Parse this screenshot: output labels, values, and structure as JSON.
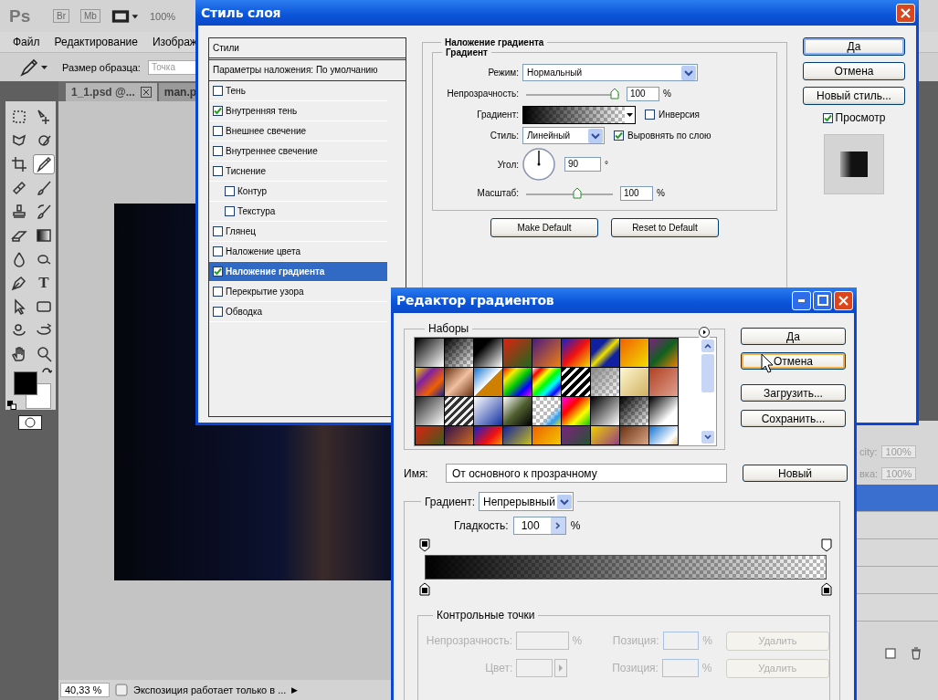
{
  "app": {
    "logo": "Ps",
    "bridge": "Br",
    "mini_bridge": "Mb",
    "zoom_level": "100%",
    "menu": [
      {
        "label": "Файл"
      },
      {
        "label": "Редактирование"
      },
      {
        "label": "Изображ"
      }
    ],
    "options": {
      "label": "Размер образца:",
      "placeholder": "Точка"
    },
    "doc_tabs": [
      {
        "label": "1_1.psd @...",
        "selected": true
      },
      {
        "label": "man.p",
        "selected": false
      }
    ],
    "tools": [
      {
        "kind": "marquee",
        "selected": false
      },
      {
        "kind": "move",
        "selected": false
      },
      {
        "kind": "lasso",
        "selected": false
      },
      {
        "kind": "quick-select",
        "selected": false
      },
      {
        "kind": "crop",
        "selected": false
      },
      {
        "kind": "eyedropper",
        "selected": true
      },
      {
        "kind": "healing",
        "selected": false
      },
      {
        "kind": "brush",
        "selected": false
      },
      {
        "kind": "stamp",
        "selected": false
      },
      {
        "kind": "history-brush",
        "selected": false
      },
      {
        "kind": "eraser",
        "selected": false
      },
      {
        "kind": "gradient",
        "selected": false
      },
      {
        "kind": "blur",
        "selected": false
      },
      {
        "kind": "smudge",
        "selected": false
      },
      {
        "kind": "pen",
        "selected": false
      },
      {
        "kind": "type",
        "label": "T",
        "selected": false
      },
      {
        "kind": "path-select",
        "selected": false
      },
      {
        "kind": "shape",
        "selected": false
      },
      {
        "kind": "rotate-3d",
        "selected": false
      },
      {
        "kind": "orbit-3d",
        "selected": false
      },
      {
        "kind": "hand",
        "selected": false
      },
      {
        "kind": "zoom",
        "selected": false
      }
    ],
    "status": {
      "zoom": "40,33 %",
      "message": "Экспозиция работает только в ...",
      "arrow": "▶"
    },
    "layers_panel": {
      "fields": [
        {
          "label": "city:",
          "value": "100%",
          "disabled": true
        },
        {
          "label": "вка:",
          "value": "100%",
          "disabled": true
        }
      ],
      "rows": [
        {
          "selected": true
        },
        {
          "selected": false
        },
        {
          "selected": false
        },
        {
          "selected": false
        },
        {
          "selected": false
        }
      ]
    }
  },
  "layer_style": {
    "title": "Стиль слоя",
    "styles_header": "Стили",
    "blending": "Параметры наложения: По умолчанию",
    "effects": [
      {
        "label": "Тень",
        "checked": false,
        "selected": false
      },
      {
        "label": "Внутренняя тень",
        "checked": true,
        "selected": false
      },
      {
        "label": "Внешнее свечение",
        "checked": false,
        "selected": false
      },
      {
        "label": "Внутреннее свечение",
        "checked": false,
        "selected": false
      },
      {
        "label": "Тиснение",
        "checked": false,
        "selected": false,
        "children": [
          {
            "label": "Контур",
            "checked": false,
            "selected": false
          },
          {
            "label": "Текстура",
            "checked": false,
            "selected": false
          }
        ]
      },
      {
        "label": "Глянец",
        "checked": false,
        "selected": false
      },
      {
        "label": "Наложение цвета",
        "checked": false,
        "selected": false
      },
      {
        "label": "Наложение градиента",
        "checked": true,
        "selected": true
      },
      {
        "label": "Перекрытие узора",
        "checked": false,
        "selected": false
      },
      {
        "label": "Обводка",
        "checked": false,
        "selected": false
      }
    ],
    "section_title": "Наложение градиента",
    "group_title": "Градиент",
    "mode": {
      "label": "Режим:",
      "value": "Нормальный"
    },
    "opacity": {
      "label": "Непрозрачность:",
      "level": 1,
      "value": "100",
      "unit": "%"
    },
    "gradient": {
      "label": "Градиент:"
    },
    "reverse": {
      "label": "Инверсия",
      "checked": false
    },
    "style": {
      "label": "Стиль:",
      "value": "Линейный"
    },
    "align": {
      "label": "Выровнять по слою",
      "checked": true
    },
    "angle": {
      "label": "Угол:",
      "value": "90",
      "unit": "°"
    },
    "scale": {
      "label": "Масштаб:",
      "level": 0.6,
      "value": "100",
      "unit": "%"
    },
    "buttons": [
      {
        "label": "Make Default"
      },
      {
        "label": "Reset to Default"
      }
    ],
    "side_buttons": [
      {
        "label": "Да",
        "focused": true
      },
      {
        "label": "Отмена",
        "focused": false
      },
      {
        "label": "Новый стиль...",
        "focused": false
      }
    ],
    "preview": {
      "label": "Просмотр",
      "checked": true
    }
  },
  "gradient_editor": {
    "title": "Редактор градиентов",
    "presets_label": "Наборы",
    "buttons": [
      {
        "label": "Да",
        "hovered": false
      },
      {
        "label": "Отмена",
        "hovered": true
      },
      {
        "label": "Загрузить...",
        "hovered": false
      },
      {
        "label": "Сохранить...",
        "hovered": false
      }
    ],
    "name": {
      "label": "Имя:",
      "value": "От основного к прозрачному"
    },
    "new_button": "Новый",
    "gradient_type": {
      "label": "Градиент:",
      "value": "Непрерывный"
    },
    "smoothness": {
      "label": "Гладкость:",
      "value": "100",
      "unit": "%"
    },
    "stops_title": "Контрольные точки",
    "stop_rows": [
      {
        "kind": "opacity",
        "label": "Непрозрачность:",
        "unit": "%",
        "position_label": "Позиция:",
        "position_unit": "%",
        "delete": "Удалить",
        "disabled": true
      },
      {
        "kind": "color",
        "label": "Цвет:",
        "position_label": "Позиция:",
        "position_unit": "%",
        "delete": "Удалить",
        "disabled": true
      }
    ]
  }
}
